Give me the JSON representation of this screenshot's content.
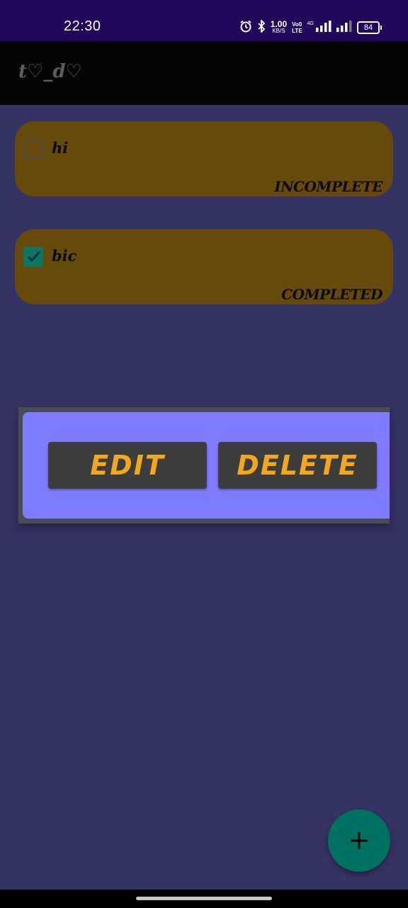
{
  "status_bar": {
    "time": "22:30",
    "net_speed_value": "1.00",
    "net_speed_unit": "KB/S",
    "volte_top": "Vo0",
    "volte_bottom": "LTE",
    "sim_label": "4G",
    "battery": "84",
    "icons": [
      "alarm-icon",
      "bluetooth-icon",
      "signal-icon",
      "signal-icon",
      "battery-icon"
    ]
  },
  "app_bar": {
    "title": "t♡_d♡"
  },
  "tasks": [
    {
      "name": "hi",
      "status": "INCOMPLETE",
      "checked": false
    },
    {
      "name": "bic",
      "status": "COMPLETED",
      "checked": true
    }
  ],
  "dialog": {
    "edit_label": "EDIT",
    "delete_label": "DELETE"
  },
  "fab": {
    "icon": "plus-icon"
  },
  "colors": {
    "background": "#353264",
    "card": "#664a0c",
    "dialog_panel": "#7f7bff",
    "button_text": "#f3a71f",
    "fab": "#007060",
    "checkbox_checked": "#0e7464"
  }
}
